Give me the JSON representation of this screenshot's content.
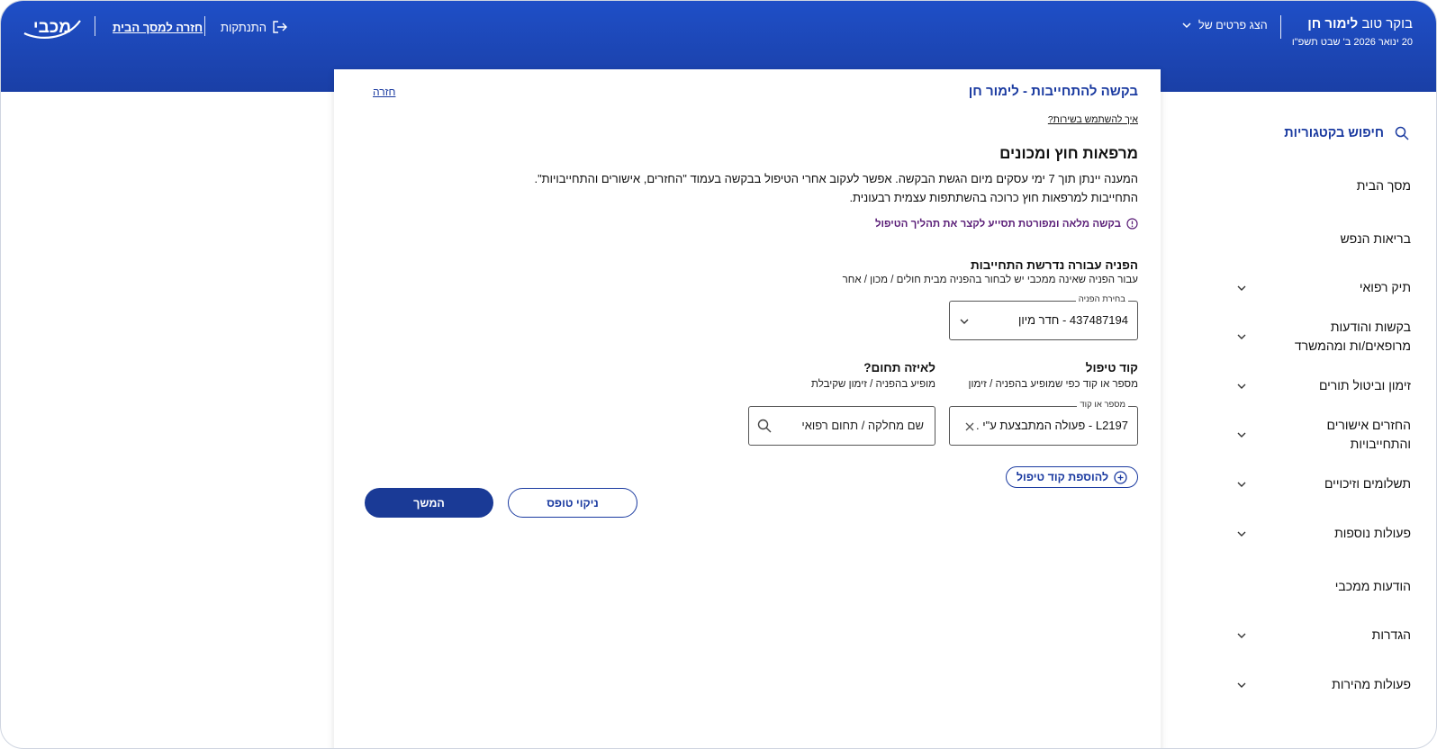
{
  "header": {
    "logo_text": "מכבי",
    "home_link": "חזרה למסך הבית",
    "logout": "התנתקות",
    "greeting_prefix": "בוקר טוב",
    "user_name": "לימור חן",
    "date": "20 ינואר 2026 ב' שבט תשפ\"ו",
    "details_toggle": "הצג פרטים של"
  },
  "sidebar": {
    "search_label": "חיפוש בקטגוריות",
    "items": [
      {
        "label": "מסך הבית"
      },
      {
        "label": "בריאות הנפש"
      },
      {
        "label": "תיק רפואי"
      },
      {
        "label": "בקשות והודעות מרופאים/ות ומהמשרד"
      },
      {
        "label": "זימון וביטול תורים"
      },
      {
        "label": "החזרים אישורים והתחייבויות"
      },
      {
        "label": "תשלומים וזיכויים"
      },
      {
        "label": "פעולות נוספות"
      },
      {
        "label": "הודעות ממכבי"
      },
      {
        "label": "הגדרות"
      },
      {
        "label": "פעולות מהירות"
      }
    ]
  },
  "form": {
    "title": "בקשה להתחייבות - לימור חן",
    "back": "חזרה",
    "help": "איך להשתמש בשירות?",
    "section_title": "מרפאות חוץ ומכונים",
    "para_1": "המענה יינתן תוך 7 ימי עסקים מיום הגשת הבקשה. אפשר לעקוב אחרי הטיפול בבקשה בעמוד \"החזרים, אישורים והתחייבויות\".",
    "para_2": "התחייבות למרפאות חוץ כרוכה בהשתתפות עצמית רבעונית.",
    "notice": "בקשה מלאה ומפורטת תסייע לקצר את תהליך הטיפול",
    "referral_title": "הפניה עבורה נדרשת התחייבות",
    "referral_sub": "עבור הפניה שאינה ממכבי יש לבחור בהפניה מבית חולים / מכון / אחר",
    "referral_legend": "בחירת הפניה",
    "referral_value": "437487194 - חדר מיון",
    "code_title": "קוד טיפול",
    "code_sub": "מספר או קוד כפי שמופיע בהפניה / זימון",
    "code_legend": "מספר או קוד",
    "code_value": "L2197 - פעולה המתבצעת ע\"י ...",
    "field_title": "לאיזה תחום?",
    "field_sub": "מופיע בהפניה / זימון שקיבלת",
    "field_placeholder": "שם מחלקה / תחום רפואי",
    "add_code": "להוספת קוד טיפול",
    "clear": "ניקוי טופס",
    "continue": "המשך"
  }
}
